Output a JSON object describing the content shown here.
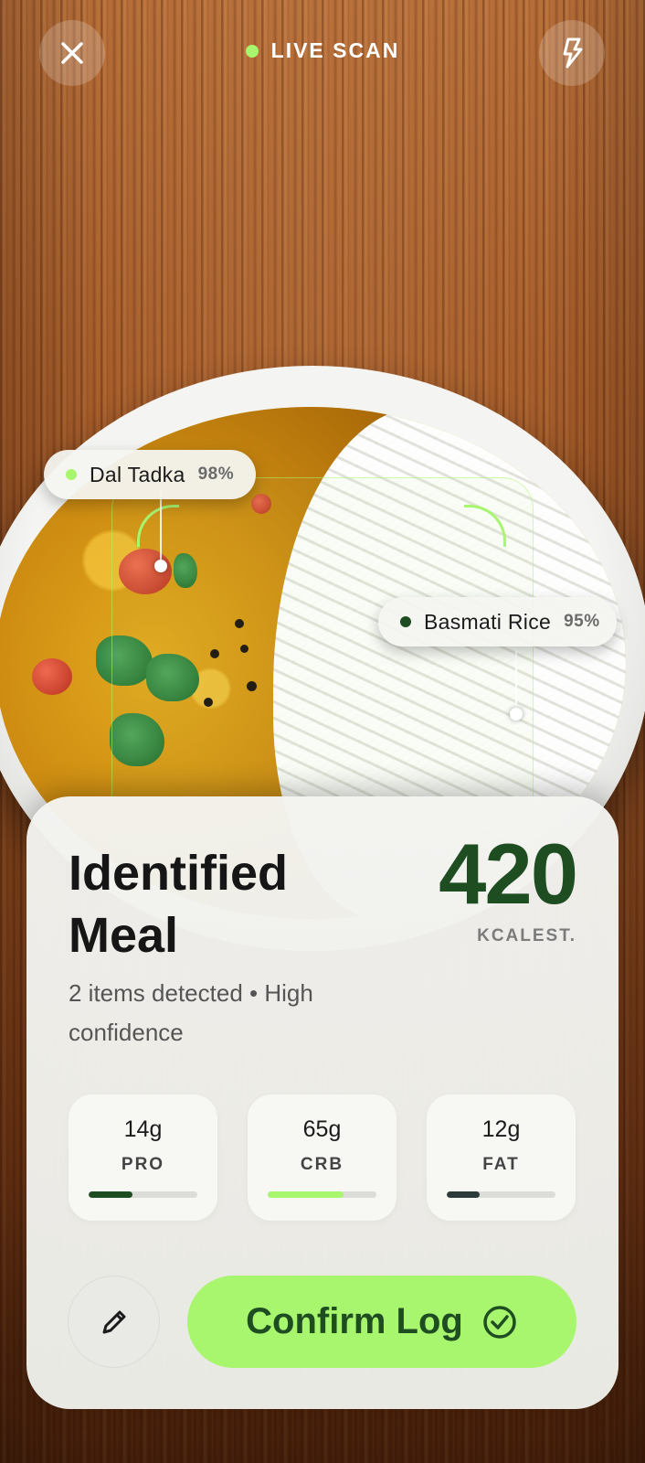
{
  "topbar": {
    "close_icon": "close-icon",
    "status_label": "LIVE SCAN",
    "status_color": "#a8f56e",
    "flash_icon": "flash-icon"
  },
  "detections": [
    {
      "name": "Dal Tadka",
      "confidence": "98%",
      "dot_color": "#a8f56e"
    },
    {
      "name": "Basmati Rice",
      "confidence": "95%",
      "dot_color": "#1f4d22"
    }
  ],
  "card": {
    "title": "Identified Meal",
    "kcal_value": "420",
    "kcal_label": "KCALEST.",
    "subtitle": "2 items detected • High confidence",
    "macros": [
      {
        "value": "14g",
        "label": "PRO",
        "fill": 0.4,
        "color": "#1f4d22"
      },
      {
        "value": "65g",
        "label": "CRB",
        "fill": 0.7,
        "color": "#a8f56e"
      },
      {
        "value": "12g",
        "label": "FAT",
        "fill": 0.3,
        "color": "#2d3a3a"
      }
    ],
    "edit_icon": "pencil-icon",
    "confirm_label": "Confirm Log",
    "confirm_icon": "check-circle-icon"
  },
  "colors": {
    "accent": "#a8f56e",
    "brand_dark": "#1f4d22"
  }
}
